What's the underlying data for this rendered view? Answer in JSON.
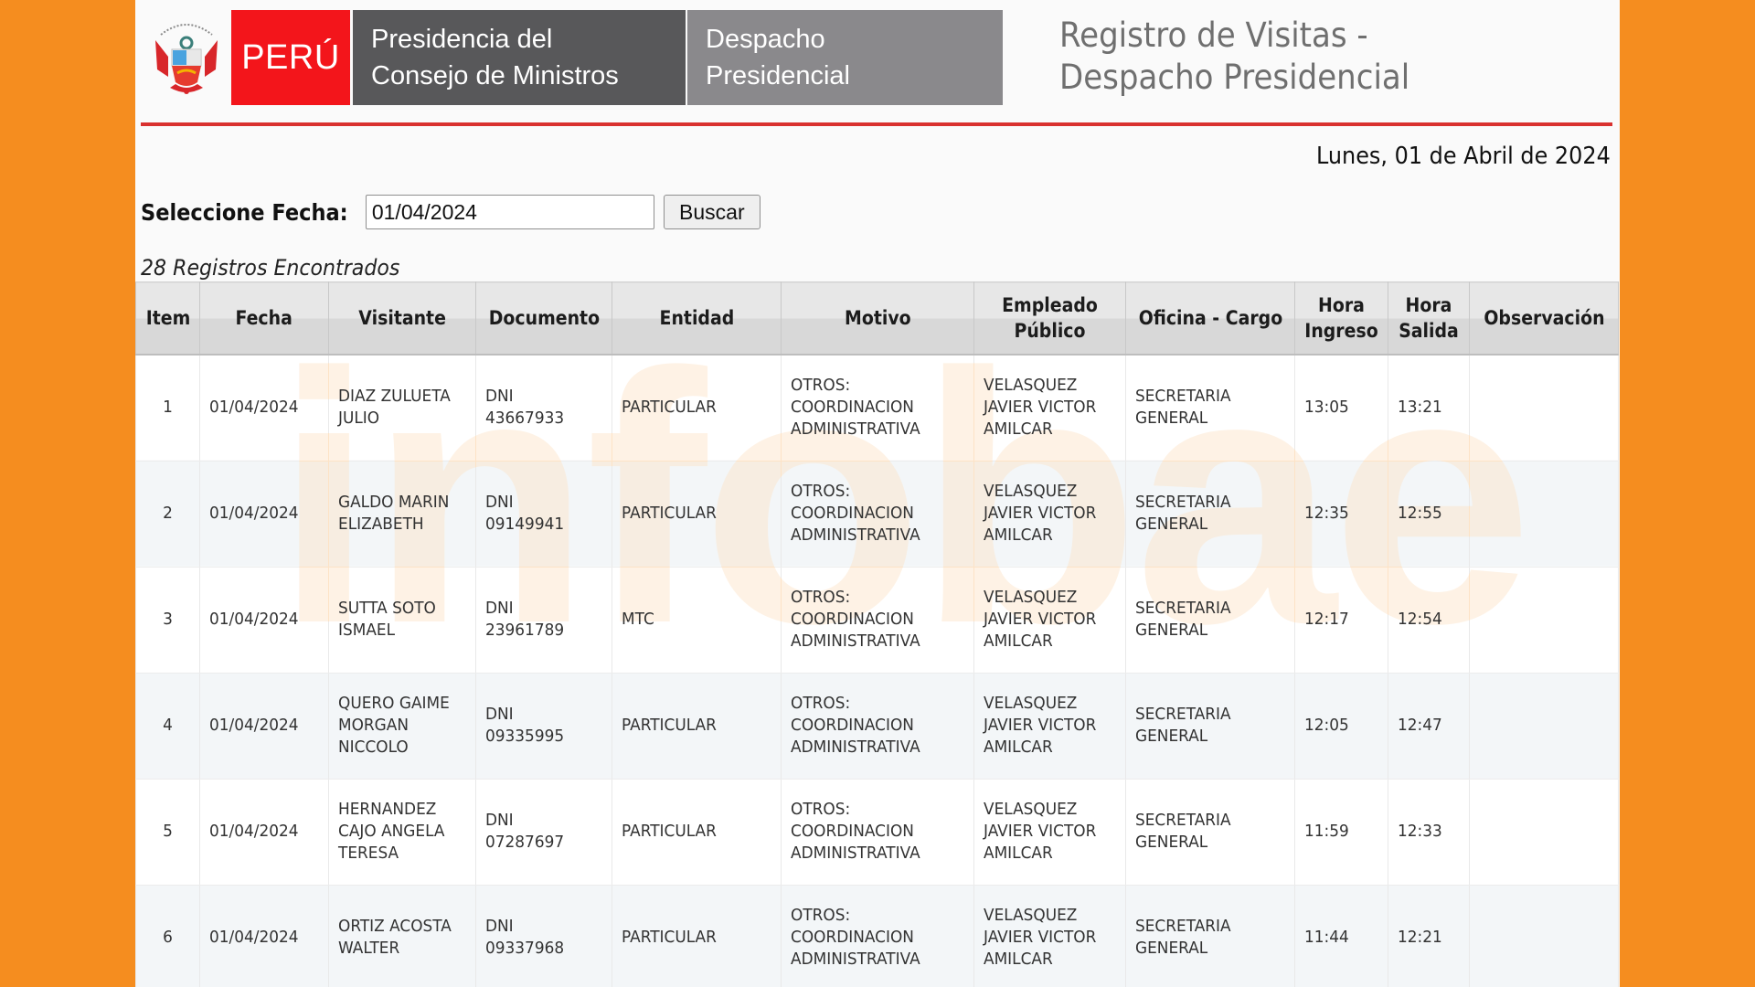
{
  "colors": {
    "frame": "#f58d1f",
    "brand_red": "#f3151b",
    "brand_dark_gray": "#58585a",
    "brand_light_gray": "#8a898c",
    "rule_red": "#d9312f",
    "watermark": "#fde3c6"
  },
  "header": {
    "emblem_icon": "peru-coat-of-arms-icon",
    "brand_country": "PERÚ",
    "brand_institution_line1": "Presidencia del",
    "brand_institution_line2": "Consejo de Ministros",
    "brand_office_line1": "Despacho",
    "brand_office_line2": "Presidencial",
    "title_line1": "Registro de Visitas -",
    "title_line2": "Despacho Presidencial"
  },
  "current_date": "Lunes, 01 de Abril de 2024",
  "search": {
    "label": "Seleccione Fecha:",
    "date_value": "01/04/2024",
    "button_label": "Buscar"
  },
  "results_count": "28 Registros Encontrados",
  "watermark_text": "infobae",
  "table": {
    "columns": [
      "Item",
      "Fecha",
      "Visitante",
      "Documento",
      "Entidad",
      "Motivo",
      "Empleado Público",
      "Oficina - Cargo",
      "Hora Ingreso",
      "Hora Salida",
      "Observación"
    ],
    "rows": [
      {
        "item": "1",
        "fecha": "01/04/2024",
        "visitante": "DIAZ ZULUETA JULIO",
        "documento": "DNI 43667933",
        "entidad": "PARTICULAR",
        "motivo": "OTROS: COORDINACION ADMINISTRATIVA",
        "empleado": "VELASQUEZ JAVIER VICTOR AMILCAR",
        "oficina": "SECRETARIA GENERAL",
        "hora_ingreso": "13:05",
        "hora_salida": "13:21",
        "observacion": ""
      },
      {
        "item": "2",
        "fecha": "01/04/2024",
        "visitante": "GALDO MARIN ELIZABETH",
        "documento": "DNI 09149941",
        "entidad": "PARTICULAR",
        "motivo": "OTROS: COORDINACION ADMINISTRATIVA",
        "empleado": "VELASQUEZ JAVIER VICTOR AMILCAR",
        "oficina": "SECRETARIA GENERAL",
        "hora_ingreso": "12:35",
        "hora_salida": "12:55",
        "observacion": ""
      },
      {
        "item": "3",
        "fecha": "01/04/2024",
        "visitante": "SUTTA SOTO ISMAEL",
        "documento": "DNI 23961789",
        "entidad": "MTC",
        "motivo": "OTROS: COORDINACION ADMINISTRATIVA",
        "empleado": "VELASQUEZ JAVIER VICTOR AMILCAR",
        "oficina": "SECRETARIA GENERAL",
        "hora_ingreso": "12:17",
        "hora_salida": "12:54",
        "observacion": ""
      },
      {
        "item": "4",
        "fecha": "01/04/2024",
        "visitante": "QUERO GAIME MORGAN NICCOLO",
        "documento": "DNI 09335995",
        "entidad": "PARTICULAR",
        "motivo": "OTROS: COORDINACION ADMINISTRATIVA",
        "empleado": "VELASQUEZ JAVIER VICTOR AMILCAR",
        "oficina": "SECRETARIA GENERAL",
        "hora_ingreso": "12:05",
        "hora_salida": "12:47",
        "observacion": ""
      },
      {
        "item": "5",
        "fecha": "01/04/2024",
        "visitante": "HERNANDEZ CAJO ANGELA TERESA",
        "documento": "DNI 07287697",
        "entidad": "PARTICULAR",
        "motivo": "OTROS: COORDINACION ADMINISTRATIVA",
        "empleado": "VELASQUEZ JAVIER VICTOR AMILCAR",
        "oficina": "SECRETARIA GENERAL",
        "hora_ingreso": "11:59",
        "hora_salida": "12:33",
        "observacion": ""
      },
      {
        "item": "6",
        "fecha": "01/04/2024",
        "visitante": "ORTIZ ACOSTA WALTER",
        "documento": "DNI 09337968",
        "entidad": "PARTICULAR",
        "motivo": "OTROS: COORDINACION ADMINISTRATIVA",
        "empleado": "VELASQUEZ JAVIER VICTOR AMILCAR",
        "oficina": "SECRETARIA GENERAL",
        "hora_ingreso": "11:44",
        "hora_salida": "12:21",
        "observacion": ""
      }
    ]
  }
}
